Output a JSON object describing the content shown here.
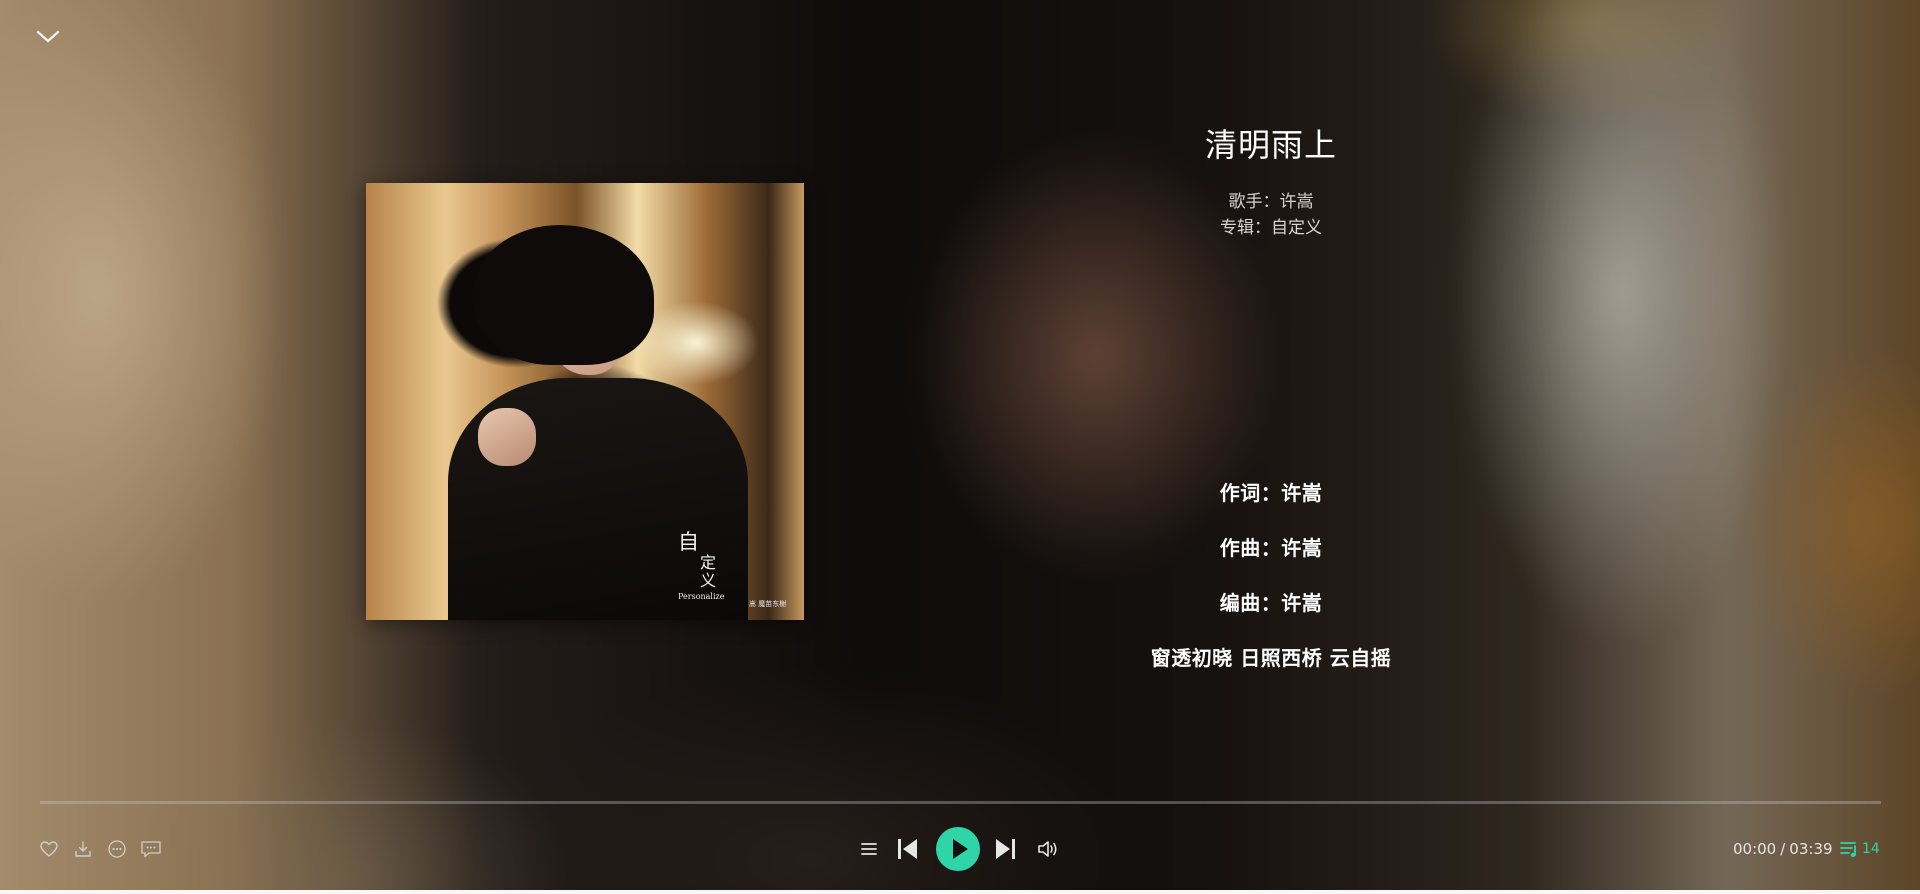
{
  "song": {
    "title": "清明雨上",
    "singer_label": "歌手：",
    "singer": "许嵩",
    "album_label": "专辑：",
    "album": "自定义"
  },
  "cover": {
    "text_line1": "自",
    "text_line2": "定",
    "text_line3": "义",
    "text_line4": "Personalize",
    "text_line5": "嵩 魔苗东榭"
  },
  "lyrics": [
    "作词：许嵩",
    "作曲：许嵩",
    "编曲：许嵩",
    "窗透初晓 日照西桥 云自摇"
  ],
  "playback": {
    "current_time": "00:00",
    "separator": "/",
    "total_time": "03:39",
    "progress_fraction": 0.0,
    "queue_count": "14"
  },
  "icons": {
    "collapse": "chevron-down-icon",
    "like": "heart-icon",
    "download": "download-icon",
    "more": "more-icon",
    "comment": "comment-icon",
    "play_mode": "list-icon",
    "prev": "previous-icon",
    "play": "play-icon",
    "next": "next-icon",
    "volume": "volume-icon",
    "queue": "playlist-icon"
  },
  "colors": {
    "accent": "#2fd4a7",
    "text_primary": "#ffffff",
    "text_secondary": "#d9d4cf"
  }
}
